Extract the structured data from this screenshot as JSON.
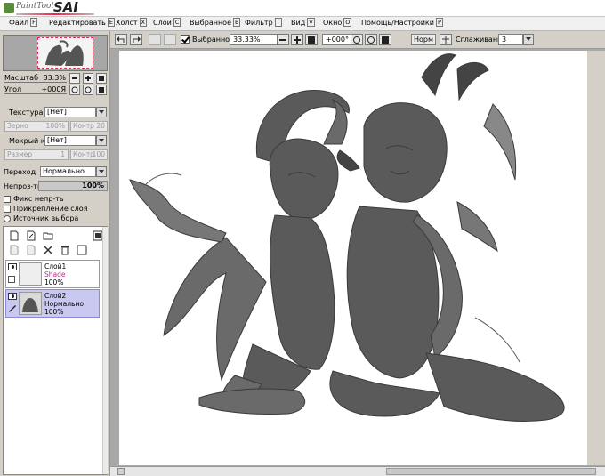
{
  "app": {
    "logo_text": "PaintTool",
    "logo_sai": "SAI"
  },
  "menu": [
    {
      "label": "Файл",
      "key": "F"
    },
    {
      "label": "Редактировать",
      "key": "E"
    },
    {
      "label": "Холст",
      "key": "X"
    },
    {
      "label": "Слой",
      "key": "C"
    },
    {
      "label": "Выбранное",
      "key": "B"
    },
    {
      "label": "Фильтр",
      "key": "T"
    },
    {
      "label": "Вид",
      "key": "V"
    },
    {
      "label": "Окно",
      "key": "O"
    },
    {
      "label": "Помощь/Настройки",
      "key": "P"
    }
  ],
  "navigator": {
    "zoom_label": "Масштаб",
    "zoom_value": "33.3%",
    "angle_label": "Угол",
    "angle_value": "+000Я"
  },
  "brush": {
    "texture_label": "Текстура",
    "texture_value": "[Нет]",
    "grain_label": "Зерно",
    "grain_value": "100%",
    "contrast_label": "Контр",
    "contrast_value": "20",
    "edge_label": "Мокрый край",
    "edge_value": "[Нет]",
    "size_label": "Размер",
    "size_value": "1",
    "contrast2_label": "Контр",
    "contrast2_value": "100"
  },
  "layer_props": {
    "blend_label": "Переход",
    "blend_value": "Нормально",
    "opacity_label": "Непроз-ть",
    "opacity_value": "100%",
    "fix_opacity": "Фикс непр-ть",
    "clip_layer": "Прикрепление слоя",
    "selection_source": "Источник выбора"
  },
  "layers": [
    {
      "name": "Слой1",
      "mode": "Shade",
      "opacity": "100%",
      "selected": false
    },
    {
      "name": "Слой2",
      "mode": "Нормально",
      "opacity": "100%",
      "selected": true
    }
  ],
  "toolbar": {
    "selection_label": "Выбранное",
    "zoom_value": "33.33%",
    "angle_value": "+000°",
    "normal_button": "Норм",
    "stabilizer_label": "Сглаживание",
    "stabilizer_value": "3"
  }
}
